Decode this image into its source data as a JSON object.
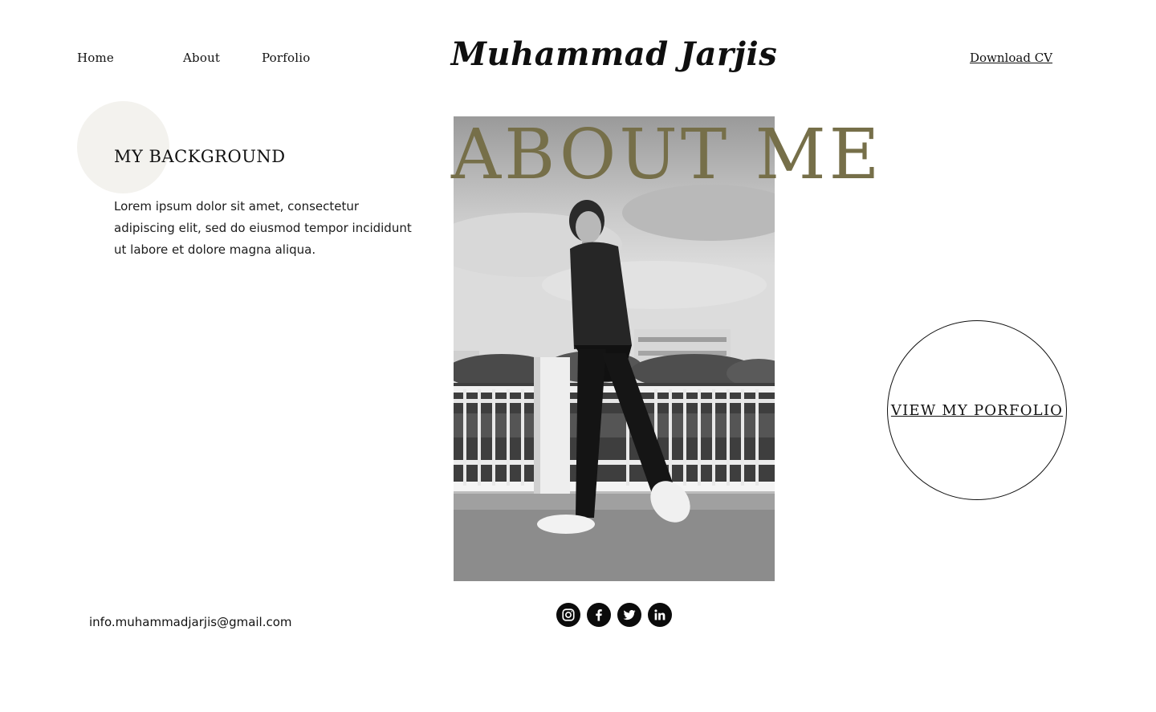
{
  "nav": {
    "links": [
      {
        "label": "Home"
      },
      {
        "label": "About"
      },
      {
        "label": "Porfolio"
      }
    ],
    "brand": "Muhammad Jarjis",
    "download_label": "Download CV"
  },
  "background": {
    "heading": "MY BACKGROUND",
    "body": "Lorem ipsum dolor sit amet, consectetur adipiscing elit, sed do eiusmod tempor incididunt ut labore et dolore magna aliqua."
  },
  "hero": {
    "title": "ABOUT ME"
  },
  "portfolio": {
    "label": "VIEW MY PORFOLIO"
  },
  "footer": {
    "email": "info.muhammadjarjis@gmail.com",
    "socials": [
      "instagram-icon",
      "facebook-icon",
      "twitter-icon",
      "linkedin-icon"
    ]
  },
  "colors": {
    "accent": "#766f49",
    "circle_fill": "#f3f2ee",
    "text": "#111111"
  }
}
